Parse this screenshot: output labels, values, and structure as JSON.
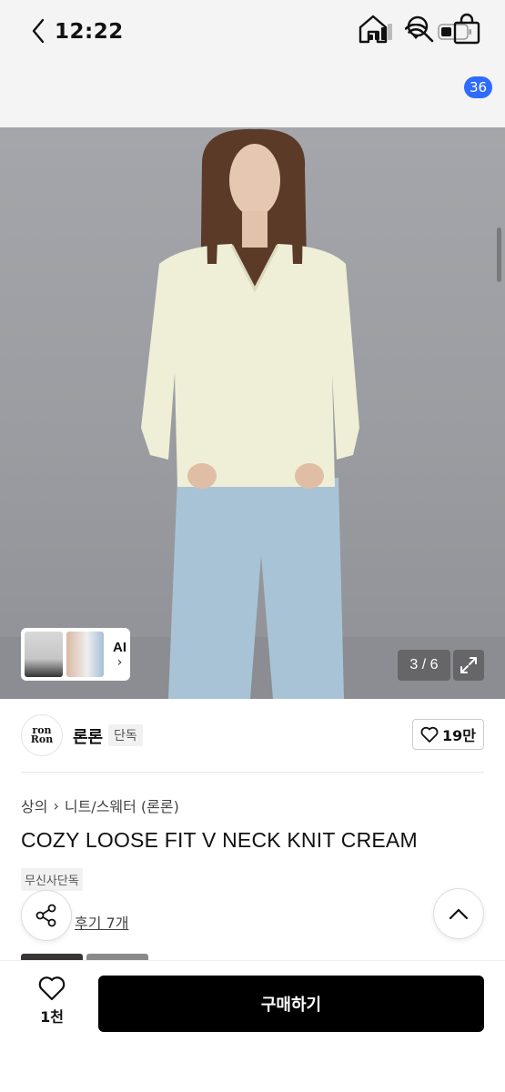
{
  "status_bar": {
    "time": "12:22"
  },
  "nav": {
    "cart_count": "36"
  },
  "image": {
    "counter": "3 / 6",
    "ai_label": "AI"
  },
  "brand": {
    "logo_line1": "ron",
    "logo_line2": "Ron",
    "name": "론론",
    "exclusive_label": "단독",
    "likes": "19만"
  },
  "breadcrumb": {
    "category": "상의",
    "subcategory": "니트/스웨터 (론론)"
  },
  "product": {
    "title": "COZY LOOSE FIT V NECK KNIT CREAM",
    "tag": "무신사단독",
    "review_link": "후기 7개"
  },
  "bottom": {
    "like_count": "1천",
    "buy_label": "구매하기"
  },
  "colors": {
    "accent_badge": "#2f6bff",
    "buy_button": "#000000"
  }
}
